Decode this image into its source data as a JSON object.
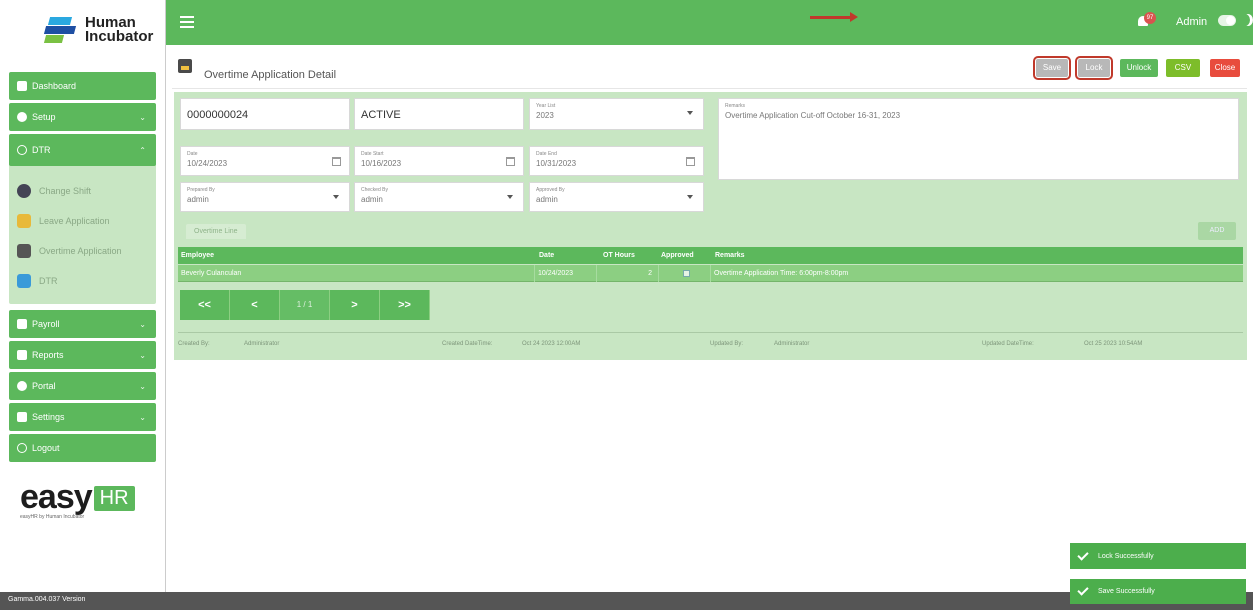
{
  "brand": {
    "line1": "Human",
    "line2": "Incubator",
    "easy_word": "easy",
    "easy_hr": "HR",
    "easy_tag": "easyHR by Human Incubator"
  },
  "sidebar": {
    "items_top": [
      {
        "label": "Dashboard"
      },
      {
        "label": "Setup"
      }
    ],
    "dtr_group": {
      "label": "DTR",
      "subitems": [
        {
          "label": "Change Shift"
        },
        {
          "label": "Leave Application"
        },
        {
          "label": "Overtime Application"
        },
        {
          "label": "DTR"
        }
      ]
    },
    "items_bottom": [
      {
        "label": "Payroll"
      },
      {
        "label": "Reports"
      },
      {
        "label": "Portal"
      },
      {
        "label": "Settings"
      },
      {
        "label": "Logout"
      }
    ]
  },
  "topbar": {
    "notif_count": "97",
    "user": "Admin"
  },
  "page": {
    "title": "Overtime Application Detail"
  },
  "toolbar": {
    "save": "Save",
    "lock": "Lock",
    "unlock": "Unlock",
    "csv": "CSV",
    "close": "Close"
  },
  "form": {
    "number": "0000000024",
    "status": "ACTIVE",
    "year_label": "Year List",
    "year": "2023",
    "date_label": "Date",
    "date": "10/24/2023",
    "date_start_label": "Date Start",
    "date_start": "10/16/2023",
    "date_end_label": "Date End",
    "date_end": "10/31/2023",
    "prepared_label": "Prepared By",
    "prepared": "admin",
    "checked_label": "Checked By",
    "checked": "admin",
    "approved_label": "Approved By",
    "approved": "admin",
    "remarks_label": "Remarks",
    "remarks": "Overtime Application Cut-off October 16-31, 2023"
  },
  "tab": {
    "label": "Overtime Line"
  },
  "add_button": "ADD",
  "grid": {
    "headers": {
      "employee": "Employee",
      "date": "Date",
      "hours": "OT Hours",
      "approved": "Approved",
      "remarks": "Remarks"
    },
    "rows": [
      {
        "employee": "Beverly Culanculan",
        "date": "10/24/2023",
        "hours": "2",
        "approved": true,
        "remarks": "Overtime Application Time: 6:00pm-8:00pm"
      }
    ]
  },
  "pager": {
    "first": "<<",
    "prev": "<",
    "page": "1 / 1",
    "next": ">",
    "last": ">>"
  },
  "meta": {
    "created_by_label": "Created By:",
    "created_by": "Administrator",
    "created_dt_label": "Created DateTime:",
    "created_dt": "Oct 24 2023 12:00AM",
    "updated_by_label": "Updated By:",
    "updated_by": "Administrator",
    "updated_dt_label": "Updated DateTime:",
    "updated_dt": "Oct 25 2023 10:54AM"
  },
  "toasts": [
    "Lock Successfully",
    "Save Successfully"
  ],
  "status": {
    "version": "Gamma.004.037 Version"
  },
  "colors": {
    "primary": "#5cb85c",
    "panel": "#c8e6c3",
    "danger": "#e84c3d",
    "csv": "#7dbd2a",
    "disabled": "#b8b8b8"
  }
}
